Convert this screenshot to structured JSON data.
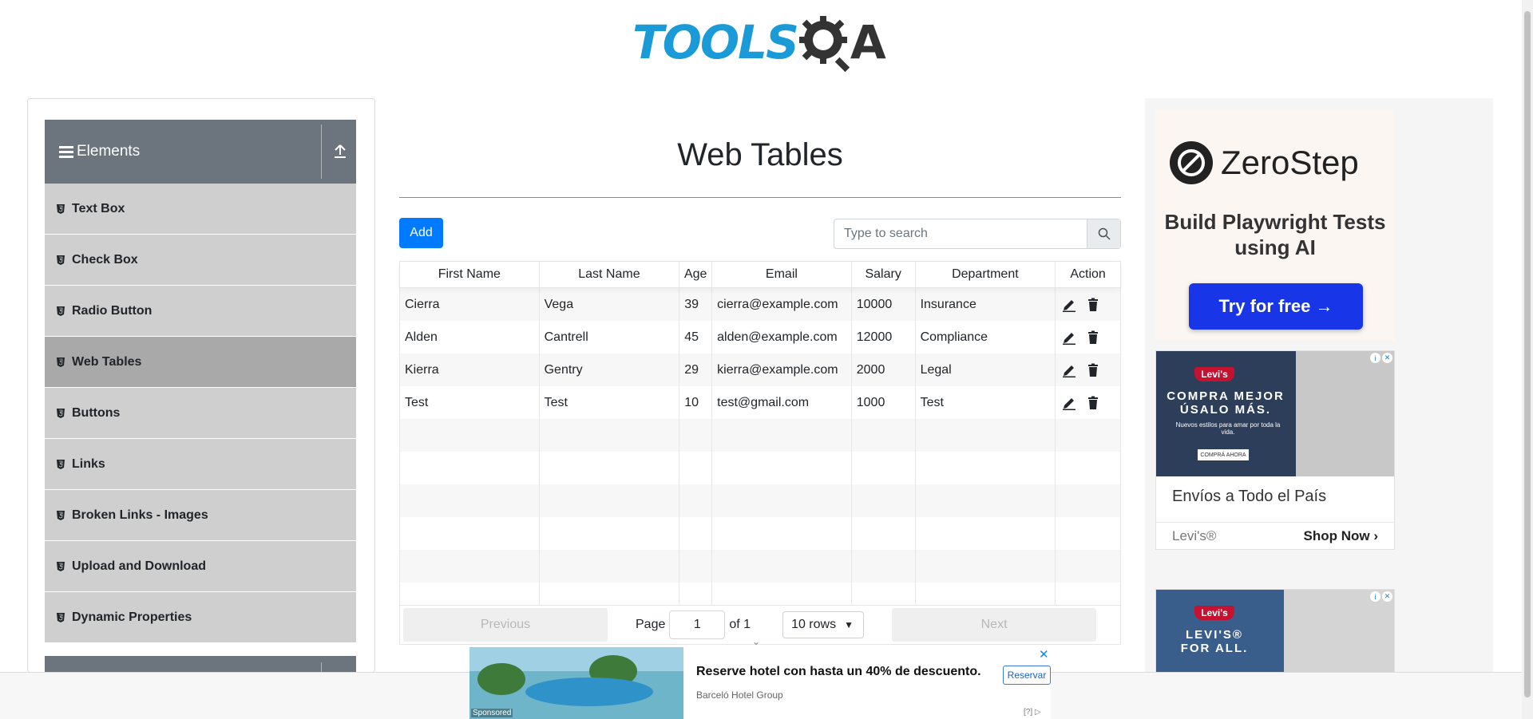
{
  "header": {
    "logo_text": "TOOLS",
    "logo_suffix": "A"
  },
  "sidebar": {
    "group_title": "Elements",
    "items": [
      {
        "label": "Text Box"
      },
      {
        "label": "Check Box"
      },
      {
        "label": "Radio Button"
      },
      {
        "label": "Web Tables",
        "active": true
      },
      {
        "label": "Buttons"
      },
      {
        "label": "Links"
      },
      {
        "label": "Broken Links - Images"
      },
      {
        "label": "Upload and Download"
      },
      {
        "label": "Dynamic Properties"
      }
    ]
  },
  "main": {
    "title": "Web Tables",
    "add_label": "Add",
    "search": {
      "placeholder": "Type to search"
    },
    "table": {
      "columns": [
        "First Name",
        "Last Name",
        "Age",
        "Email",
        "Salary",
        "Department",
        "Action"
      ],
      "rows": [
        [
          "Cierra",
          "Vega",
          "39",
          "cierra@example.com",
          "10000",
          "Insurance"
        ],
        [
          "Alden",
          "Cantrell",
          "45",
          "alden@example.com",
          "12000",
          "Compliance"
        ],
        [
          "Kierra",
          "Gentry",
          "29",
          "kierra@example.com",
          "2000",
          "Legal"
        ],
        [
          "Test",
          "Test",
          "10",
          "test@gmail.com",
          "1000",
          "Test"
        ]
      ]
    },
    "pagination": {
      "previous": "Previous",
      "page_label": "Page",
      "page_value": "1",
      "of_label": "of 1",
      "rows_option": "10 rows",
      "next": "Next"
    }
  },
  "ads": {
    "zerostep": {
      "brand": "ZeroStep",
      "tagline": "Build Playwright Tests using AI",
      "cta": "Try for free →"
    },
    "levis1": {
      "logo": "Levi's",
      "headline": "COMPRA MEJOR ÚSALO MÁS.",
      "sub": "Nuevos estilos para amar por toda la vida.",
      "cta_small": "COMPRÁ AHORA",
      "title": "Envíos a Todo el País",
      "brand": "Levi's®",
      "shop": "Shop Now"
    },
    "levis2": {
      "logo": "Levi's",
      "headline": "LEVI'S® FOR ALL."
    },
    "bottom": {
      "sponsored": "Sponsored",
      "text": "Reserve hotel con hasta un 40% de descuento.",
      "advertiser": "Barceló Hotel Group",
      "button": "Reservar",
      "help": "[?]"
    }
  },
  "colors": {
    "primary": "#007bff",
    "sidebar_header": "#6c757d",
    "menu_bg": "#cfcfcf",
    "menu_active": "#a9a9a9",
    "logo_blue": "#1a9ad7"
  }
}
